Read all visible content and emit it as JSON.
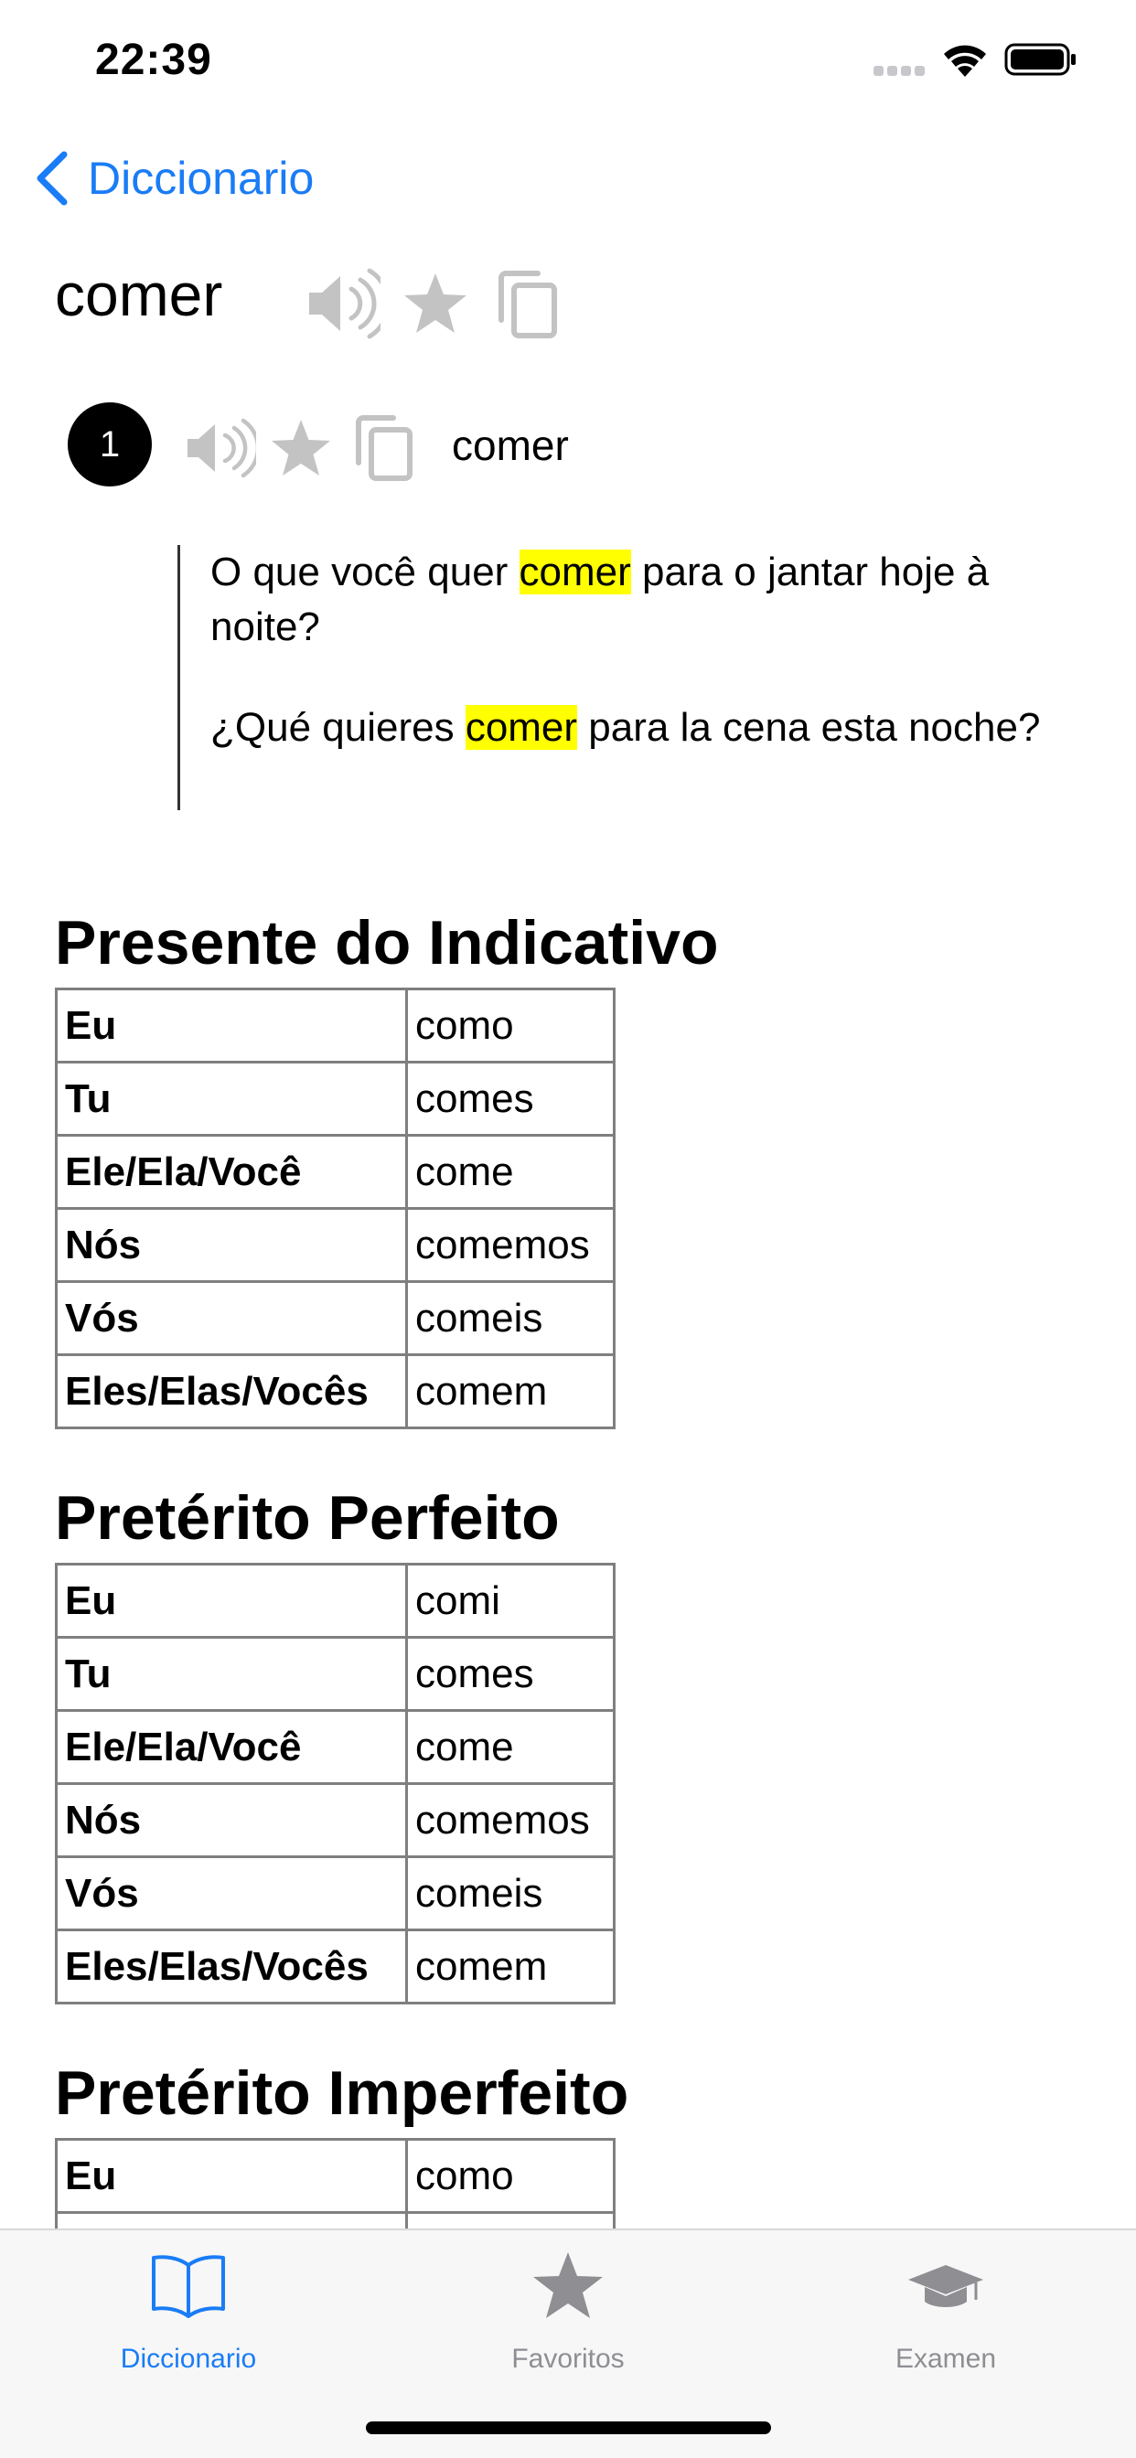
{
  "status_bar": {
    "time": "22:39"
  },
  "nav": {
    "back_label": "Diccionario"
  },
  "entry": {
    "headword": "comer",
    "sense": {
      "number": "1",
      "word": "comer",
      "example_pt": {
        "before": "O que você quer ",
        "highlight": "comer",
        "after": " para o jantar hoje à noite?"
      },
      "example_es": {
        "before": "¿Qué quieres ",
        "highlight": "comer",
        "after": " para la cena esta noche?"
      }
    }
  },
  "conjugations": [
    {
      "title": "Presente do Indicativo",
      "rows": [
        {
          "person": "Eu",
          "form": "como"
        },
        {
          "person": "Tu",
          "form": "comes"
        },
        {
          "person": "Ele/Ela/Você",
          "form": "come"
        },
        {
          "person": "Nós",
          "form": "comemos"
        },
        {
          "person": "Vós",
          "form": "comeis"
        },
        {
          "person": "Eles/Elas/Vocês",
          "form": "comem"
        }
      ]
    },
    {
      "title": "Pretérito Perfeito",
      "rows": [
        {
          "person": "Eu",
          "form": "comi"
        },
        {
          "person": "Tu",
          "form": "comes"
        },
        {
          "person": "Ele/Ela/Você",
          "form": "come"
        },
        {
          "person": "Nós",
          "form": "comemos"
        },
        {
          "person": "Vós",
          "form": "comeis"
        },
        {
          "person": "Eles/Elas/Vocês",
          "form": "comem"
        }
      ]
    },
    {
      "title": "Pretérito Imperfeito",
      "rows": [
        {
          "person": "Eu",
          "form": "como"
        }
      ]
    }
  ],
  "tabs": [
    {
      "label": "Diccionario",
      "icon": "book-icon",
      "active": true
    },
    {
      "label": "Favoritos",
      "icon": "star-icon",
      "active": false
    },
    {
      "label": "Examen",
      "icon": "graduation-cap-icon",
      "active": false
    }
  ],
  "colors": {
    "accent": "#1a7cf6",
    "icon_gray": "#c3c3c3",
    "highlight": "#ffff00",
    "inactive_tab": "#8e8e93"
  }
}
